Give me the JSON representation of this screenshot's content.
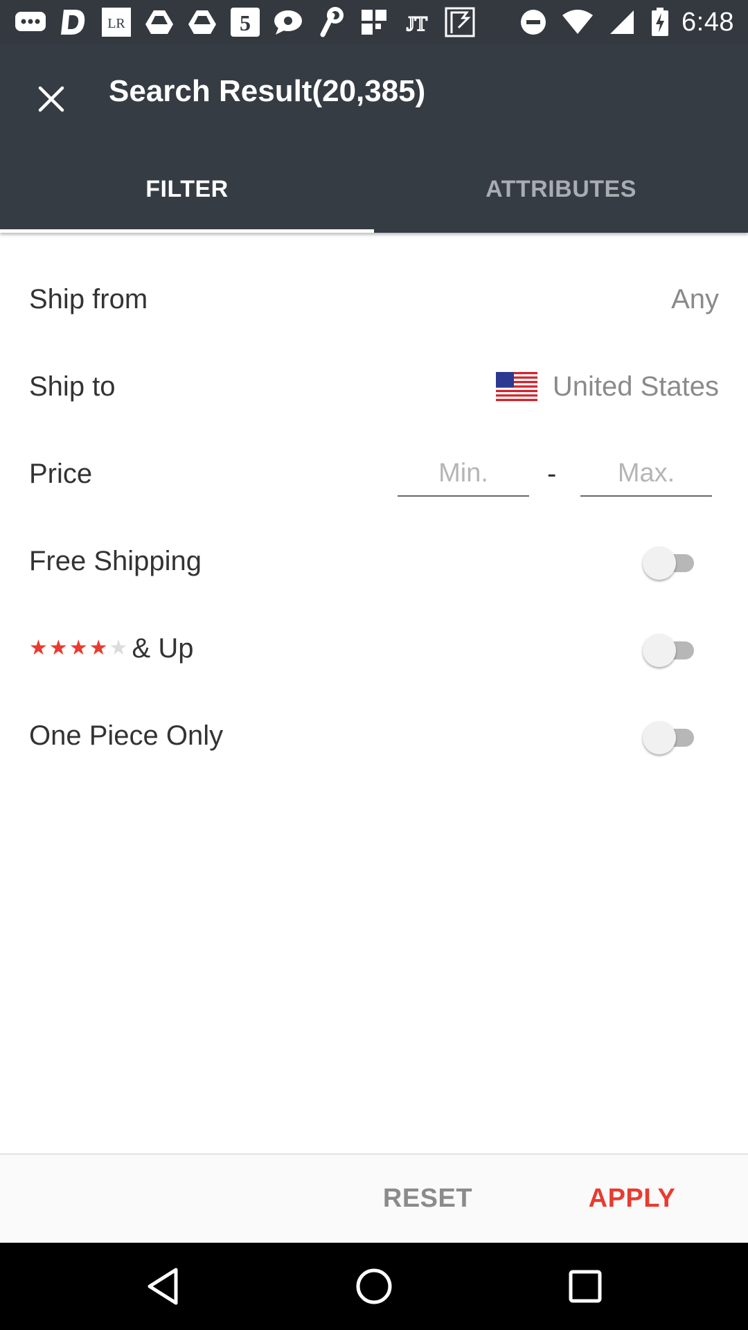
{
  "status_bar": {
    "time": "6:48",
    "notification_icons": [
      "messages-icon",
      "d-app-icon",
      "lr-icon",
      "drive-icon",
      "drive-icon",
      "5-app-icon",
      "chat-icon",
      "link-icon",
      "grid-icon",
      "jt-icon",
      "flipboard-icon"
    ],
    "system_icons": [
      "do-not-disturb-icon",
      "wifi-icon",
      "signal-icon",
      "battery-charging-icon"
    ]
  },
  "app_bar": {
    "title": "Search Result(20,385)",
    "close_icon": "close-icon"
  },
  "tabs": [
    {
      "label": "FILTER",
      "selected": true
    },
    {
      "label": "ATTRIBUTES",
      "selected": false
    }
  ],
  "filters": {
    "ship_from": {
      "label": "Ship from",
      "value": "Any"
    },
    "ship_to": {
      "label": "Ship to",
      "value": "United States",
      "icon": "us-flag-icon"
    },
    "price": {
      "label": "Price",
      "min_placeholder": "Min.",
      "max_placeholder": "Max.",
      "separator": "-"
    },
    "free_shipping": {
      "label": "Free Shipping",
      "enabled": false
    },
    "rating": {
      "label": "& Up",
      "stars_filled": 4,
      "stars_total": 5,
      "enabled": false
    },
    "one_piece_only": {
      "label": "One Piece Only",
      "enabled": false
    }
  },
  "actions": {
    "reset_label": "RESET",
    "apply_label": "APPLY"
  },
  "colors": {
    "app_bar": "#363c43",
    "accent": "#e93b2f",
    "star_filled": "#e93b2f",
    "star_empty": "#dcdcdc"
  },
  "nav_bar": {
    "icons": [
      "back-icon",
      "home-icon",
      "recents-icon"
    ]
  }
}
